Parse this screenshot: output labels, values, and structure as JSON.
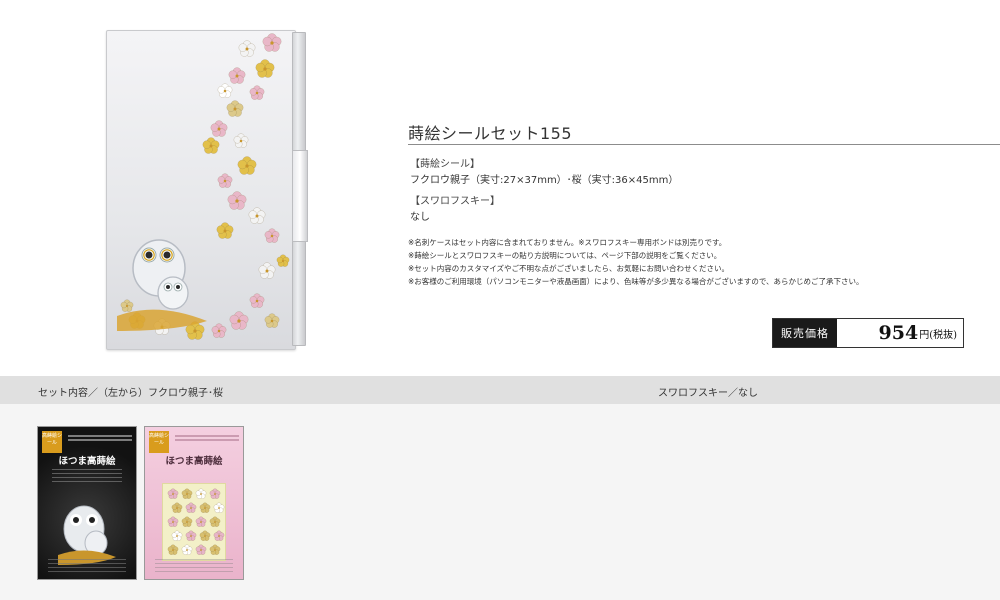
{
  "product": {
    "title": "蒔絵シールセット155",
    "makie_label": "【蒔絵シール】",
    "makie_text": "フクロウ親子（実寸:27×37mm）･桜（実寸:36×45mm）",
    "swarovski_label": "【スワロフスキー】",
    "swarovski_text": "なし",
    "notes": [
      "※名刺ケースはセット内容に含まれておりません。※スワロフスキー専用ボンドは別売りです。",
      "※蒔絵シールとスワロフスキーの貼り方説明については、ページ下部の説明をご覧ください。",
      "※セット内容のカスタマイズやご不明な点がございましたら、お気軽にお問い合わせください。",
      "※お客様のご利用環境（パソコンモニターや液晶画面）により、色味等が多少異なる場合がございますので、あらかじめご了承下さい。"
    ]
  },
  "price": {
    "label": "販売価格",
    "value": "954",
    "unit": "円",
    "tax": "(税抜)"
  },
  "contents": {
    "left_heading": "セット内容／（左から）フクロウ親子･桜",
    "right_heading": "スワロフスキー／なし"
  },
  "packages": [
    {
      "badge": "高蒔絵シール",
      "title": "ほつま高蒔絵",
      "theme": "black"
    },
    {
      "badge": "高蒔絵シール",
      "title": "ほつま高蒔絵",
      "theme": "pink"
    }
  ]
}
